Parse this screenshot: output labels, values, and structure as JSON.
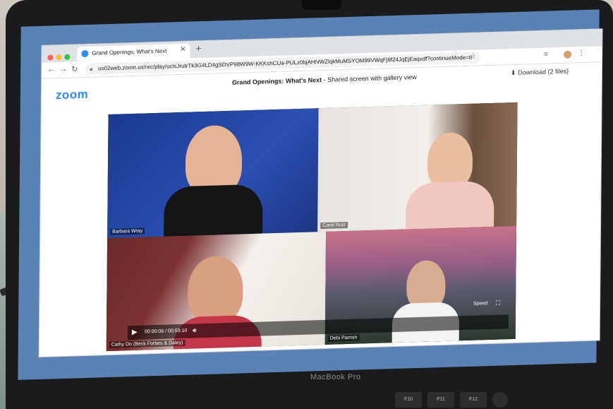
{
  "device": {
    "brand": "MacBook Pro"
  },
  "browser": {
    "tab_title": "Grand Openings: What's Next",
    "new_tab_icon": "+",
    "url": "us02web.zoom.us/rec/play/uclsJrutrTk3G4LD4gSDVP98W9W-KKKshCUa-PULz0bjAHNWZlqkMuMSYOM99VWqFj9f24JqEjEaqxdf?continueMode=true..."
  },
  "zoom": {
    "logo": "zoom",
    "title_bold": "Grand Openings: What's Next",
    "title_rest": " - Shared screen with gallery view",
    "download": "Download (2 files)"
  },
  "participants": [
    {
      "name": "Barbara Wray"
    },
    {
      "name": "Carol Ruiz"
    },
    {
      "name": "Cathy Do (Beck Forbes & Daley)"
    },
    {
      "name": "Debi Parrish"
    }
  ],
  "player": {
    "time": "00:00:06 / 00:59:10",
    "speed": "Speed"
  },
  "keys": [
    "F10",
    "F11",
    "F12",
    ""
  ]
}
